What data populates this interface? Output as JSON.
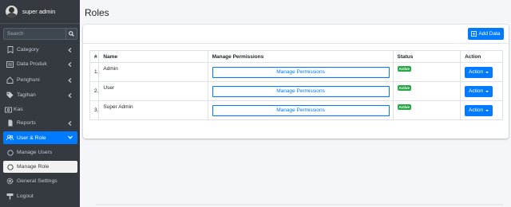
{
  "sidebar": {
    "user_name": "super admin",
    "search_placeholder": "Search",
    "items": [
      {
        "label": "Category"
      },
      {
        "label": "Data Produk"
      },
      {
        "label": "Penghuni"
      },
      {
        "label": "Tagihan"
      },
      {
        "label": "Kas"
      },
      {
        "label": "Reports"
      },
      {
        "label": "User & Role"
      },
      {
        "label": "Manage Users"
      },
      {
        "label": "Manage Role"
      },
      {
        "label": "General Settings"
      },
      {
        "label": "Logout"
      }
    ]
  },
  "main": {
    "title": "Roles",
    "add_button": "Add Data",
    "table": {
      "headers": [
        "#",
        "Name",
        "Manage Permissions",
        "Status",
        "Action"
      ],
      "rows": [
        {
          "no": "1.",
          "name": "Admin",
          "permissions": "Manage Permissions",
          "status": "Active",
          "action": "Action"
        },
        {
          "no": "2.",
          "name": "User",
          "permissions": "Manage Permissions",
          "status": "Active",
          "action": "Action"
        },
        {
          "no": "3.",
          "name": "Super Admin",
          "permissions": "Manage Permissions",
          "status": "Active",
          "action": "Action"
        }
      ]
    }
  },
  "colors": {
    "sidebar_bg": "#343a40",
    "accent": "#007bff",
    "status_active": "#28a745",
    "page_bg": "#f4f6f9"
  }
}
